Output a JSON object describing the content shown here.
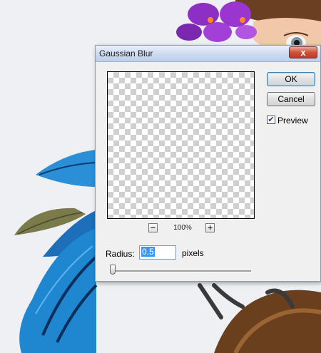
{
  "dialog": {
    "title": "Gaussian Blur",
    "close_label": "x",
    "zoom_level": "100%",
    "zoom_out_label": "−",
    "zoom_in_label": "+",
    "ok_label": "OK",
    "cancel_label": "Cancel",
    "preview_label": "Preview",
    "preview_checked": true,
    "check_glyph": "✔",
    "radius_label": "Radius:",
    "radius_value": "0.5",
    "radius_units": "pixels"
  },
  "colors": {
    "accent_selection": "#3399ff",
    "close_button": "#c23a22"
  }
}
